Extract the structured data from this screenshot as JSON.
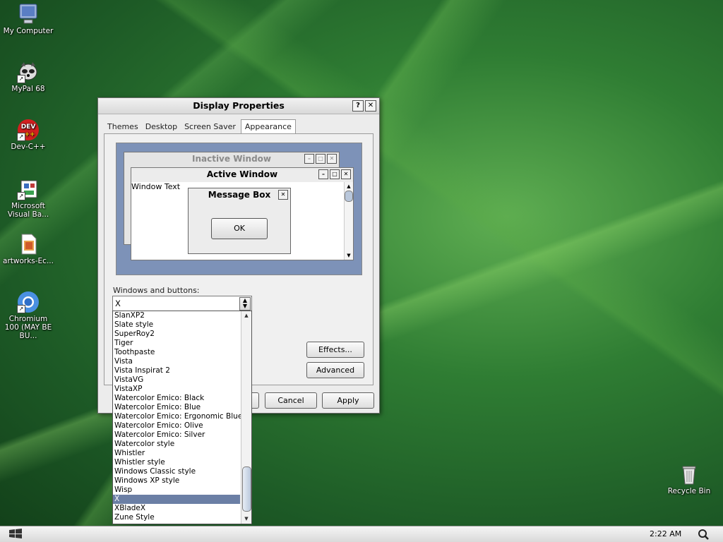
{
  "desktop": {
    "icons": [
      {
        "label": "My Computer",
        "icon": "computer-icon"
      },
      {
        "label": "MyPal 68",
        "icon": "raccoon-icon"
      },
      {
        "label": "Dev-C++",
        "icon": "devcpp-icon",
        "badge": "DEV\n++"
      },
      {
        "label": "Microsoft Visual Ba...",
        "icon": "visual-basic-icon"
      },
      {
        "label": "artworks-Ec...",
        "icon": "image-file-icon"
      },
      {
        "label": "Chromium 100 (MAY BE BU...",
        "icon": "chromium-icon"
      },
      {
        "label": "Recycle Bin",
        "icon": "recycle-bin-icon"
      }
    ]
  },
  "dialog": {
    "title": "Display Properties",
    "help_btn": "?",
    "close_btn": "✕",
    "tabs": [
      {
        "label": "Themes"
      },
      {
        "label": "Desktop"
      },
      {
        "label": "Screen Saver"
      },
      {
        "label": "Appearance",
        "active": true
      }
    ],
    "preview": {
      "inactive_title": "Inactive Window",
      "active_title": "Active Window",
      "window_text": "Window Text",
      "message_title": "Message Box",
      "ok_label": "OK"
    },
    "windows_buttons_label": "Windows and buttons:",
    "windows_buttons_value": "X",
    "effects_label": "Effects...",
    "advanced_label": "Advanced",
    "cancel_label": "Cancel",
    "apply_label": "Apply"
  },
  "dropdown": {
    "items": [
      "SlanXP2",
      "Slate style",
      "SuperRoy2",
      "Tiger",
      "Toothpaste",
      "Vista",
      "Vista Inspirat 2",
      "VistaVG",
      "VistaXP",
      "Watercolor Emico: Black",
      "Watercolor Emico: Blue",
      "Watercolor Emico: Ergonomic Blue",
      "Watercolor Emico: Olive",
      "Watercolor Emico: Silver",
      "Watercolor style",
      "Whistler",
      "Whistler style",
      "Windows Classic style",
      "Windows XP style",
      "Wisp",
      "X",
      "XBladeX",
      "Zune Style"
    ],
    "selected": "X"
  },
  "taskbar": {
    "clock": "2:22 AM"
  }
}
